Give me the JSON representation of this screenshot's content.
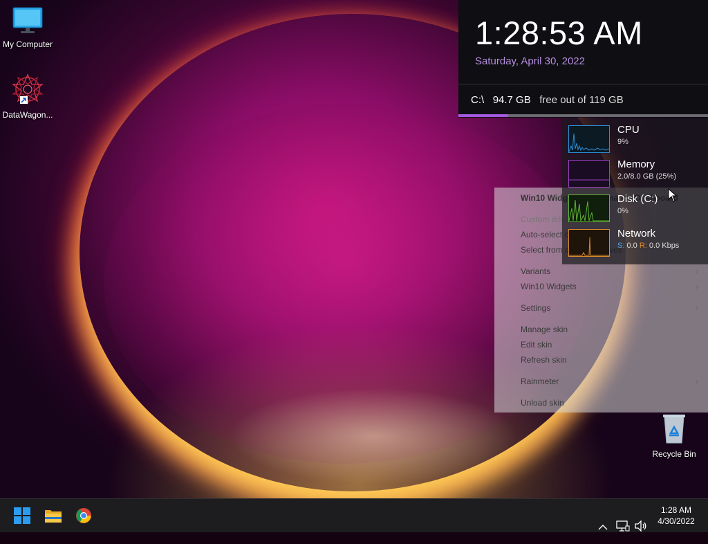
{
  "desktop": {
    "icons": [
      {
        "label": "My Computer"
      },
      {
        "label": "DataWagon..."
      },
      {
        "label": "Recycle Bin"
      }
    ]
  },
  "clock_widget": {
    "time": "1:28:53 AM",
    "date": "Saturday, April 30, 2022",
    "drive_letter": "C:\\",
    "drive_free": "94.7 GB",
    "drive_text": "free out of 119 GB",
    "drive_used_fraction": 0.2
  },
  "context_menu": {
    "title": "Win10 Widgets\\Performance\\Dashboard",
    "items": [
      {
        "label": "Custom drive"
      },
      {
        "label": "Auto-select drive"
      },
      {
        "label": "Select from available drives"
      },
      {
        "label": "Variants"
      },
      {
        "label": "Win10 Widgets"
      },
      {
        "label": "Settings"
      },
      {
        "label": "Manage skin"
      },
      {
        "label": "Edit skin"
      },
      {
        "label": "Refresh skin"
      },
      {
        "label": "Rainmeter"
      },
      {
        "label": "Unload skin"
      }
    ]
  },
  "performance": {
    "cpu": {
      "name": "CPU",
      "value": "9%",
      "color": "#2a8fd6"
    },
    "memory": {
      "name": "Memory",
      "value": "2.0/8.0 GB (25%)",
      "color": "#9b3fc0"
    },
    "disk": {
      "name": "Disk (C:)",
      "value": "0%",
      "color": "#5fb336"
    },
    "network": {
      "name": "Network",
      "s_label": "S:",
      "s_value": "0.0",
      "r_label": "R:",
      "r_value": "0.0 Kbps",
      "color": "#d98a2c"
    }
  },
  "taskbar": {
    "clock_time": "1:28 AM",
    "clock_date": "4/30/2022",
    "icons": [
      "start-icon",
      "file-explorer-icon",
      "chrome-icon"
    ],
    "tray_icons": [
      "chevron-up-icon",
      "network-icon",
      "volume-icon"
    ]
  }
}
